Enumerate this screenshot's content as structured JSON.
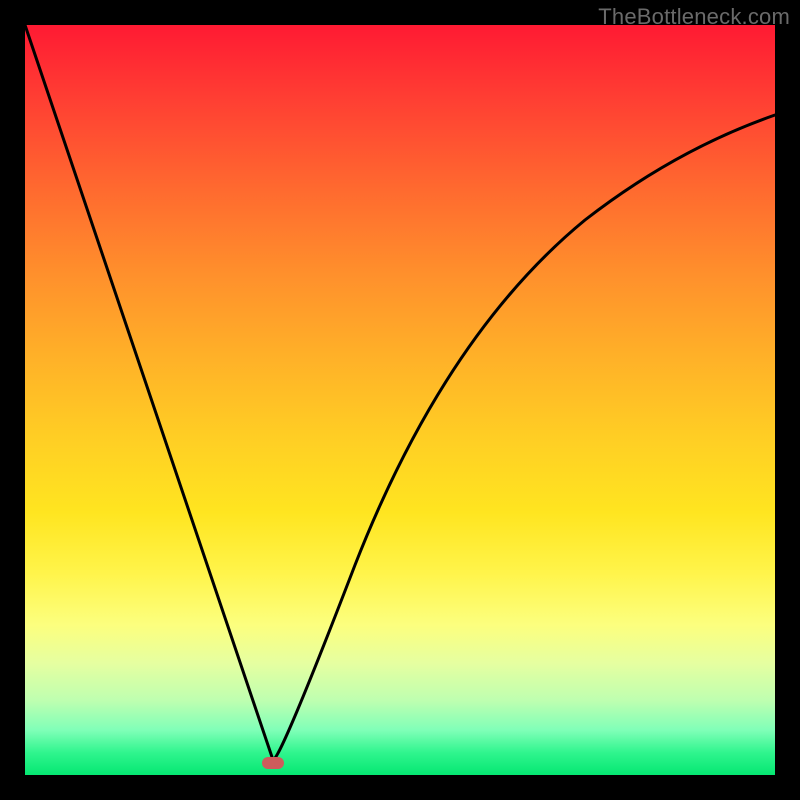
{
  "watermark": "TheBottleneck.com",
  "colors": {
    "background": "#000000",
    "curve": "#000000",
    "marker": "#cd5c5c",
    "gradient_top": "#ff1a33",
    "gradient_bottom": "#05e772"
  },
  "chart_data": {
    "type": "line",
    "title": "",
    "xlabel": "",
    "ylabel": "",
    "xlim": [
      0,
      100
    ],
    "ylim": [
      0,
      100
    ],
    "x": [
      0,
      5,
      10,
      15,
      20,
      25,
      30,
      33,
      35,
      40,
      45,
      50,
      55,
      60,
      65,
      70,
      75,
      80,
      85,
      90,
      95,
      100
    ],
    "values": [
      100,
      85,
      70,
      55,
      40,
      25,
      11,
      0,
      9,
      25,
      38,
      48,
      56,
      62,
      67,
      71,
      75,
      78,
      80,
      82,
      84,
      85
    ],
    "minimum_x": 33,
    "marker": {
      "x": 33,
      "y": 0
    }
  }
}
